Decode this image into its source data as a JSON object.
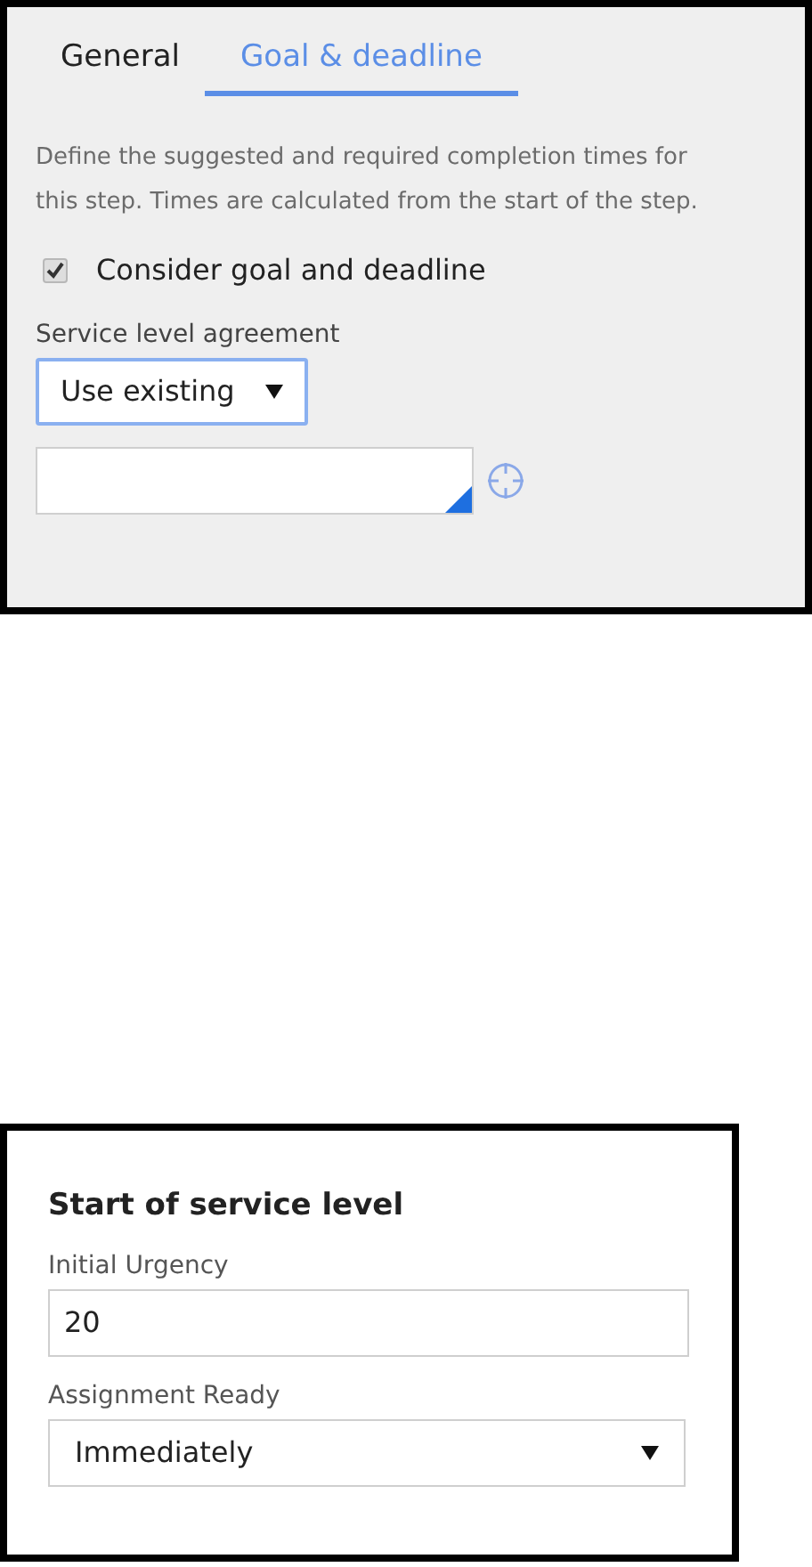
{
  "tabs": [
    {
      "label": "General",
      "selected": false
    },
    {
      "label": "Goal & deadline",
      "selected": true
    }
  ],
  "description": "Define the suggested and required completion times for this step. Times are calculated from the start of the step.",
  "consider_checkbox": {
    "label": "Consider goal and deadline",
    "checked": true
  },
  "sla": {
    "label": "Service level agreement",
    "selected_option": "Use existing"
  },
  "start_panel": {
    "title": "Start of service level",
    "initial_urgency": {
      "label": "Initial Urgency",
      "value": "20"
    },
    "assignment_ready": {
      "label": "Assignment Ready",
      "value": "Immediately"
    }
  }
}
